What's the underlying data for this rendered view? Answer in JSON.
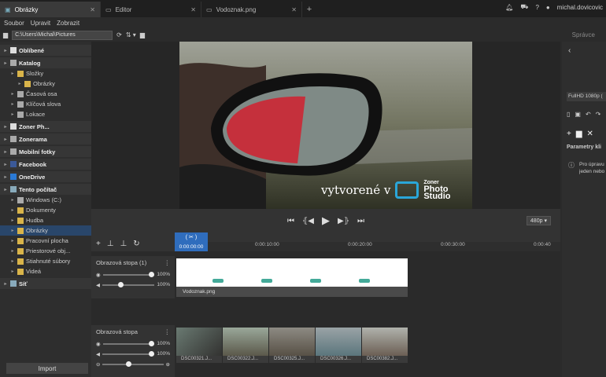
{
  "tabs": [
    {
      "label": "Obrázky",
      "active": true
    },
    {
      "label": "Editor",
      "active": false
    },
    {
      "label": "Vodoznak.png",
      "active": false
    }
  ],
  "user": "michal.dovicovic",
  "menu": [
    "Soubor",
    "Upravit",
    "Zobrazit"
  ],
  "path": "C:\\Users\\Michal\\Pictures",
  "spravce": "Správce",
  "tree": [
    {
      "label": "Oblíbené",
      "section": true,
      "icon": "star-icon"
    },
    {
      "label": "Katalog",
      "section": true,
      "icon": "catalog-icon"
    },
    {
      "label": "Složky",
      "level": 1,
      "icon": "folder-icon"
    },
    {
      "label": "Obrázky",
      "level": 2,
      "icon": "folder-icon"
    },
    {
      "label": "Časová osa",
      "level": 1,
      "icon": "calendar-icon"
    },
    {
      "label": "Klíčová slova",
      "level": 1,
      "icon": "tag-icon"
    },
    {
      "label": "Lokace",
      "level": 1,
      "icon": "pin-icon"
    },
    {
      "label": "Zoner Ph...",
      "section": true,
      "icon": "cloud-icon"
    },
    {
      "label": "Zonerama",
      "section": true,
      "icon": "zonerama-icon"
    },
    {
      "label": "Mobilní fotky",
      "section": true,
      "icon": "phone-icon"
    },
    {
      "label": "Facebook",
      "section": true,
      "icon": "facebook-icon"
    },
    {
      "label": "OneDrive",
      "section": true,
      "icon": "onedrive-icon"
    },
    {
      "label": "Tento počítač",
      "section": true,
      "icon": "computer-icon"
    },
    {
      "label": "Windows (C:)",
      "level": 1,
      "icon": "drive-icon"
    },
    {
      "label": "Dokumenty",
      "level": 1,
      "icon": "folder-icon"
    },
    {
      "label": "Hudba",
      "level": 1,
      "icon": "folder-icon"
    },
    {
      "label": "Obrázky",
      "level": 1,
      "icon": "folder-icon",
      "selected": true
    },
    {
      "label": "Pracovní plocha",
      "level": 1,
      "icon": "folder-icon"
    },
    {
      "label": "Priestorové obj...",
      "level": 1,
      "icon": "folder-icon"
    },
    {
      "label": "Stiahnuté súbory",
      "level": 1,
      "icon": "folder-icon"
    },
    {
      "label": "Videá",
      "level": 1,
      "icon": "folder-icon"
    },
    {
      "label": "Síť",
      "section": true,
      "icon": "network-icon"
    }
  ],
  "import_label": "Import",
  "watermark": {
    "prefix": "vytvorené v",
    "brand1": "Zoner",
    "brand2": "Photo",
    "brand3": "Studio"
  },
  "resolution": "480p",
  "timecode": "0:00:00:00",
  "ruler": [
    {
      "t": "0:00:10:00"
    },
    {
      "t": "0:00:20:00"
    },
    {
      "t": "0:00:30:00"
    },
    {
      "t": "0:00:40"
    }
  ],
  "track1": {
    "name": "Obrazová stopa (1)",
    "opacity": "100%",
    "volume": "100%",
    "clip": "Vodoznak.png"
  },
  "track2": {
    "name": "Obrazová stopa",
    "opacity": "100%",
    "volume": "100%",
    "clips": [
      "DSC00321.J...",
      "DSC00322.J...",
      "DSC00325.J...",
      "DSC00326.J...",
      "DSC00382.J..."
    ]
  },
  "right": {
    "preset": "FullHD 1080p (",
    "params": "Parametry kli",
    "info": "Pro úpravu jeden nebo"
  }
}
